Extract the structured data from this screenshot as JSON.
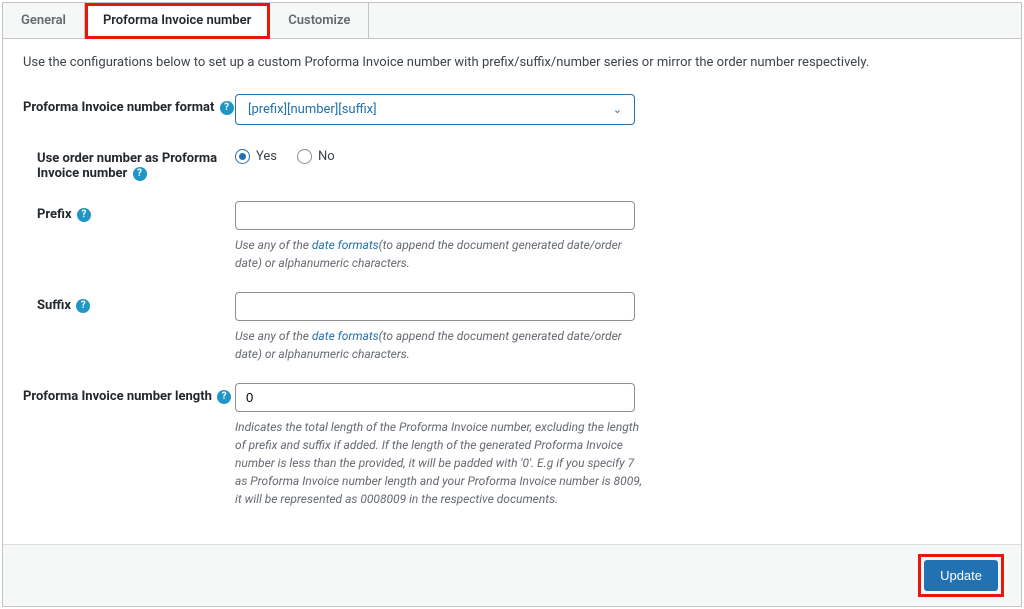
{
  "tabs": {
    "general": "General",
    "proforma": "Proforma Invoice number",
    "customize": "Customize"
  },
  "intro": "Use the configurations below to set up a custom Proforma Invoice number with prefix/suffix/number series or mirror the order number respectively.",
  "fields": {
    "format": {
      "label": "Proforma Invoice number format",
      "value": "[prefix][number][suffix]"
    },
    "use_order": {
      "label": "Use order number as Proforma Invoice number",
      "yes": "Yes",
      "no": "No"
    },
    "prefix": {
      "label": "Prefix",
      "value": "",
      "helper_pre": "Use any of the ",
      "helper_link": "date formats",
      "helper_post": "(to append the document generated date/order date) or alphanumeric characters."
    },
    "suffix": {
      "label": "Suffix",
      "value": "",
      "helper_pre": "Use any of the ",
      "helper_link": "date formats",
      "helper_post": "(to append the document generated date/order date) or alphanumeric characters."
    },
    "length": {
      "label": "Proforma Invoice number length",
      "value": "0",
      "helper": "Indicates the total length of the Proforma Invoice number, excluding the length of prefix and suffix if added. If the length of the generated Proforma Invoice number is less than the provided, it will be padded with '0'. E.g if you specify 7 as Proforma Invoice number length and your Proforma Invoice number is 8009, it will be represented as 0008009 in the respective documents."
    }
  },
  "update": "Update"
}
